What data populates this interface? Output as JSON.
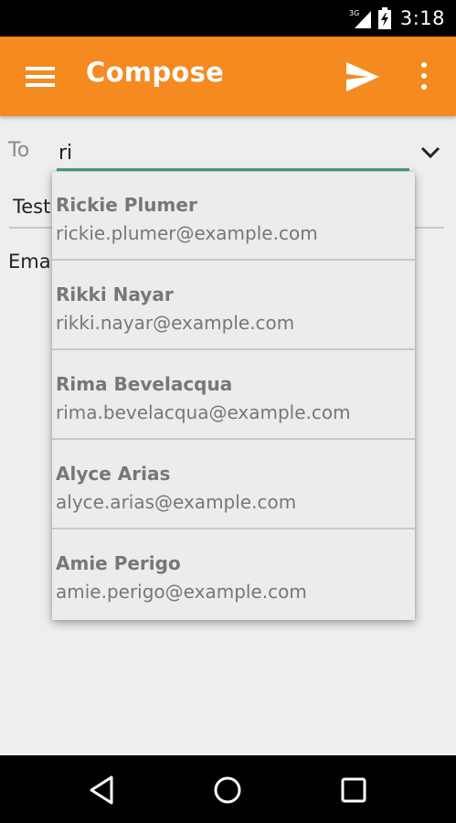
{
  "status_bar": {
    "network_label": "3G",
    "time": "3:18"
  },
  "app_bar": {
    "title": "Compose"
  },
  "compose": {
    "to_label": "To",
    "to_value": "ri",
    "subject_value": "Test",
    "body_value": "Emai"
  },
  "suggestions": [
    {
      "name": "Rickie Plumer",
      "email": "rickie.plumer@example.com"
    },
    {
      "name": "Rikki Nayar",
      "email": "rikki.nayar@example.com"
    },
    {
      "name": "Rima Bevelacqua",
      "email": "rima.bevelacqua@example.com"
    },
    {
      "name": "Alyce Arias",
      "email": "alyce.arias@example.com"
    },
    {
      "name": "Amie Perigo",
      "email": "amie.perigo@example.com"
    }
  ],
  "colors": {
    "app_bar": "#f58a20",
    "focus_underline": "#42a08e",
    "background": "#eeeeee"
  },
  "icons": {
    "menu": "menu-icon",
    "send": "send-icon",
    "more": "more-vert-icon",
    "expand": "chevron-down-icon",
    "back": "back-icon",
    "home": "home-icon",
    "recents": "recents-icon"
  }
}
